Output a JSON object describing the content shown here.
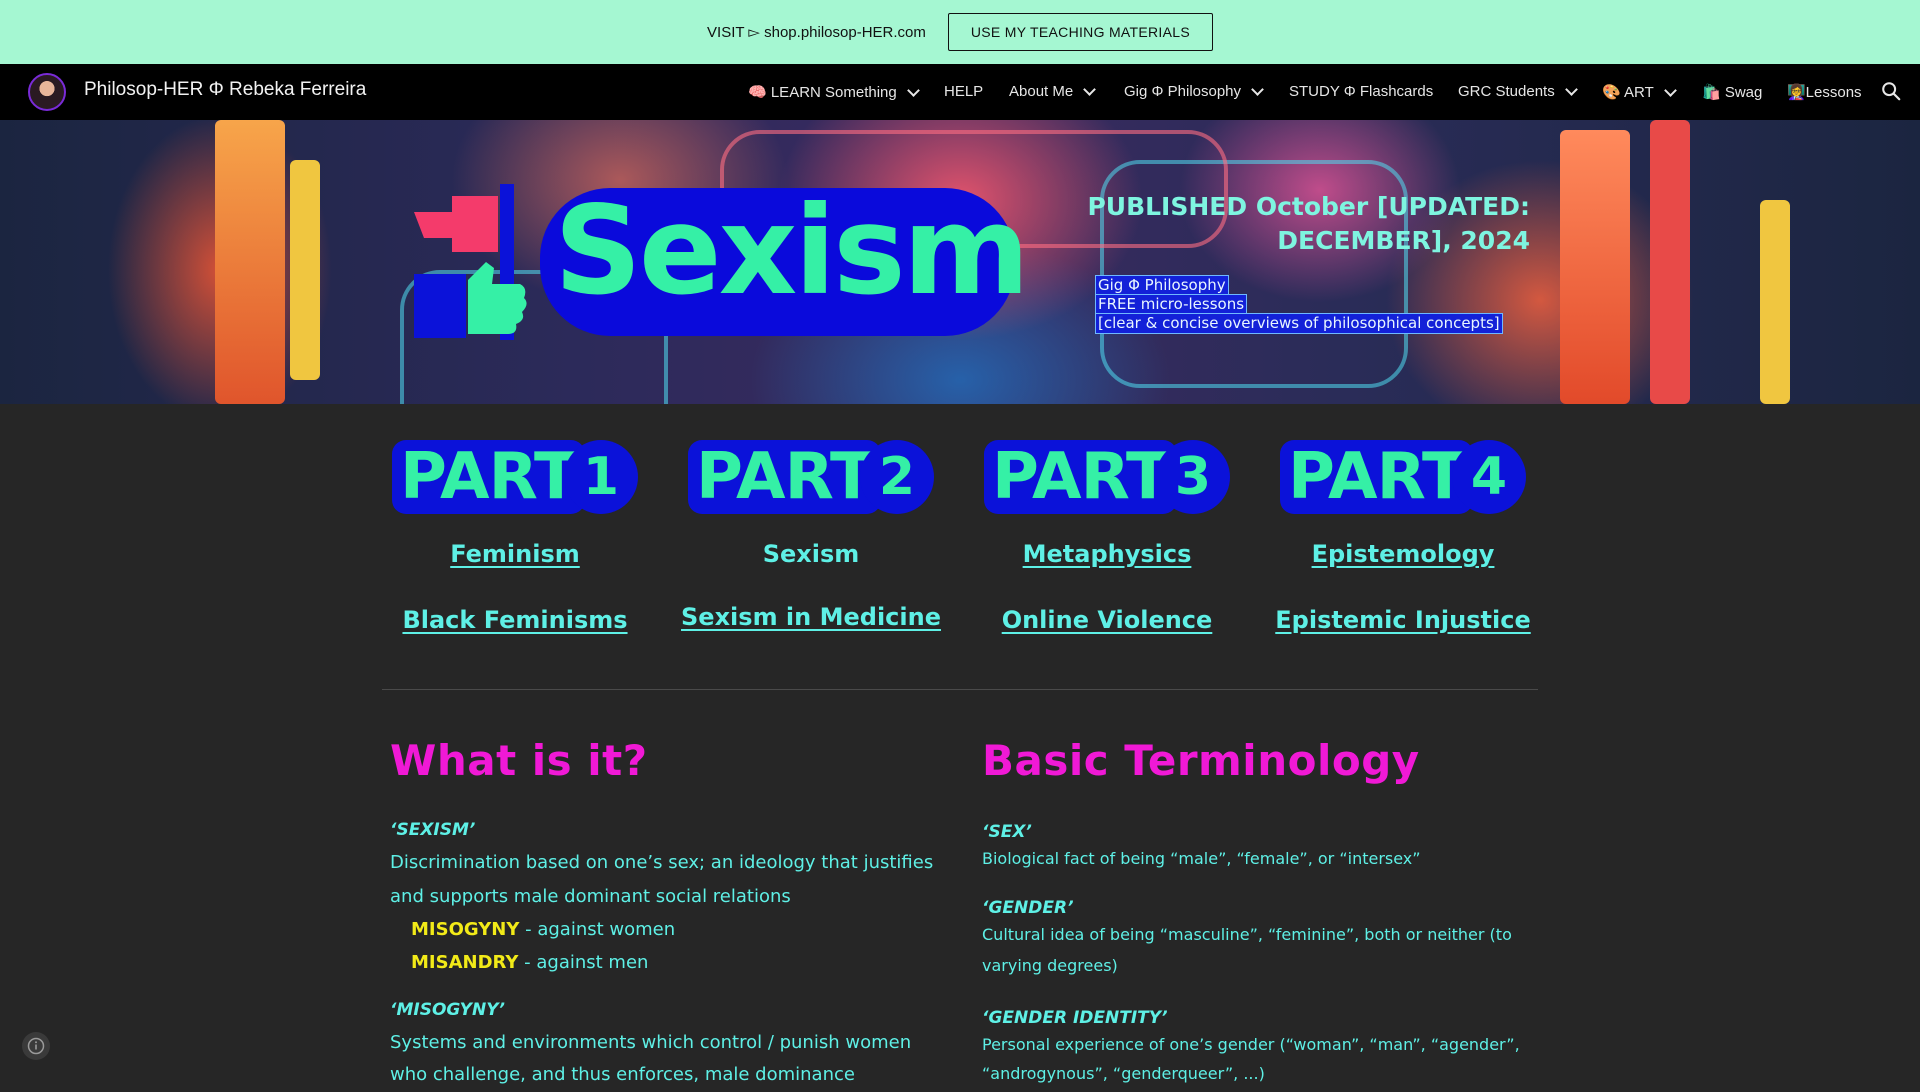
{
  "announcement": {
    "text": "VISIT ▻ shop.philosop-HER.com",
    "button": "USE MY TEACHING MATERIALS"
  },
  "nav": {
    "site_title": "Philosop-HER Φ Rebeka Ferreira",
    "items": [
      {
        "label": "🧠 LEARN Something",
        "dropdown": true
      },
      {
        "label": "HELP",
        "dropdown": false
      },
      {
        "label": "About Me",
        "dropdown": true
      },
      {
        "label": "Gig Φ Philosophy",
        "dropdown": true
      },
      {
        "label": "STUDY Φ Flashcards",
        "dropdown": false
      },
      {
        "label": "GRC Students",
        "dropdown": true
      },
      {
        "label": "🎨 ART",
        "dropdown": true
      },
      {
        "label": "🛍️ Swag",
        "dropdown": false
      },
      {
        "label": "👩‍🏫Lessons",
        "dropdown": false
      }
    ],
    "search_icon": "search-icon"
  },
  "hero": {
    "title": "Sexism",
    "published": "PUBLISHED October [UPDATED: DECEMBER], 2024",
    "sub_lines": [
      "Gig Φ Philosophy",
      "FREE micro-lessons",
      "[clear & concise overviews of philosophical concepts]"
    ]
  },
  "parts": [
    {
      "word": "PART",
      "num": "1",
      "links": [
        "Feminism",
        "Black Feminisms"
      ]
    },
    {
      "word": "PART",
      "num": "2",
      "links": [
        "Sexism",
        "Sexism in Medicine"
      ]
    },
    {
      "word": "PART",
      "num": "3",
      "links": [
        "Metaphysics",
        "Online Violence"
      ]
    },
    {
      "word": "PART",
      "num": "4",
      "links": [
        "Epistemology",
        "Epistemic Injustice"
      ]
    }
  ],
  "what_is_it": {
    "heading": "What is it?",
    "term1": "‘SEXISM’",
    "def1_line1": "Discrimination based on one’s sex; an ideology that justifies",
    "def1_line2": "and supports male dominant social relations",
    "sub1_term": "MISOGYNY",
    "sub1_rest": " - against women",
    "sub2_term": "MISANDRY",
    "sub2_rest": " - against men",
    "term2": "‘MISOGYNY’",
    "def2_line1": "Systems and environments which control / punish women",
    "def2_line2": "who challenge, and thus enforces, male dominance"
  },
  "terminology": {
    "heading": "Basic Terminology",
    "sex_term": "‘SEX’",
    "sex_def": "Biological fact of being “male”, “female”, or “intersex”",
    "gender_term": "‘GENDER’",
    "gender_def_line1": "Cultural idea of being “masculine”, “feminine”, both or neither (to",
    "gender_def_line2": "varying degrees)",
    "identity_term": "‘GENDER IDENTITY’",
    "identity_def_line1": "Personal experience of one’s gender (“woman”, “man”, “agender”,",
    "identity_def_line2": "“androgynous”, “genderqueer”, ...)"
  },
  "colors": {
    "accent_mint": "#a5f7d2",
    "heading_magenta": "#f019d6",
    "text_cyan": "#5ef0e6",
    "highlight_yellow": "#f2ea18",
    "badge_blue": "#0b12d9"
  }
}
